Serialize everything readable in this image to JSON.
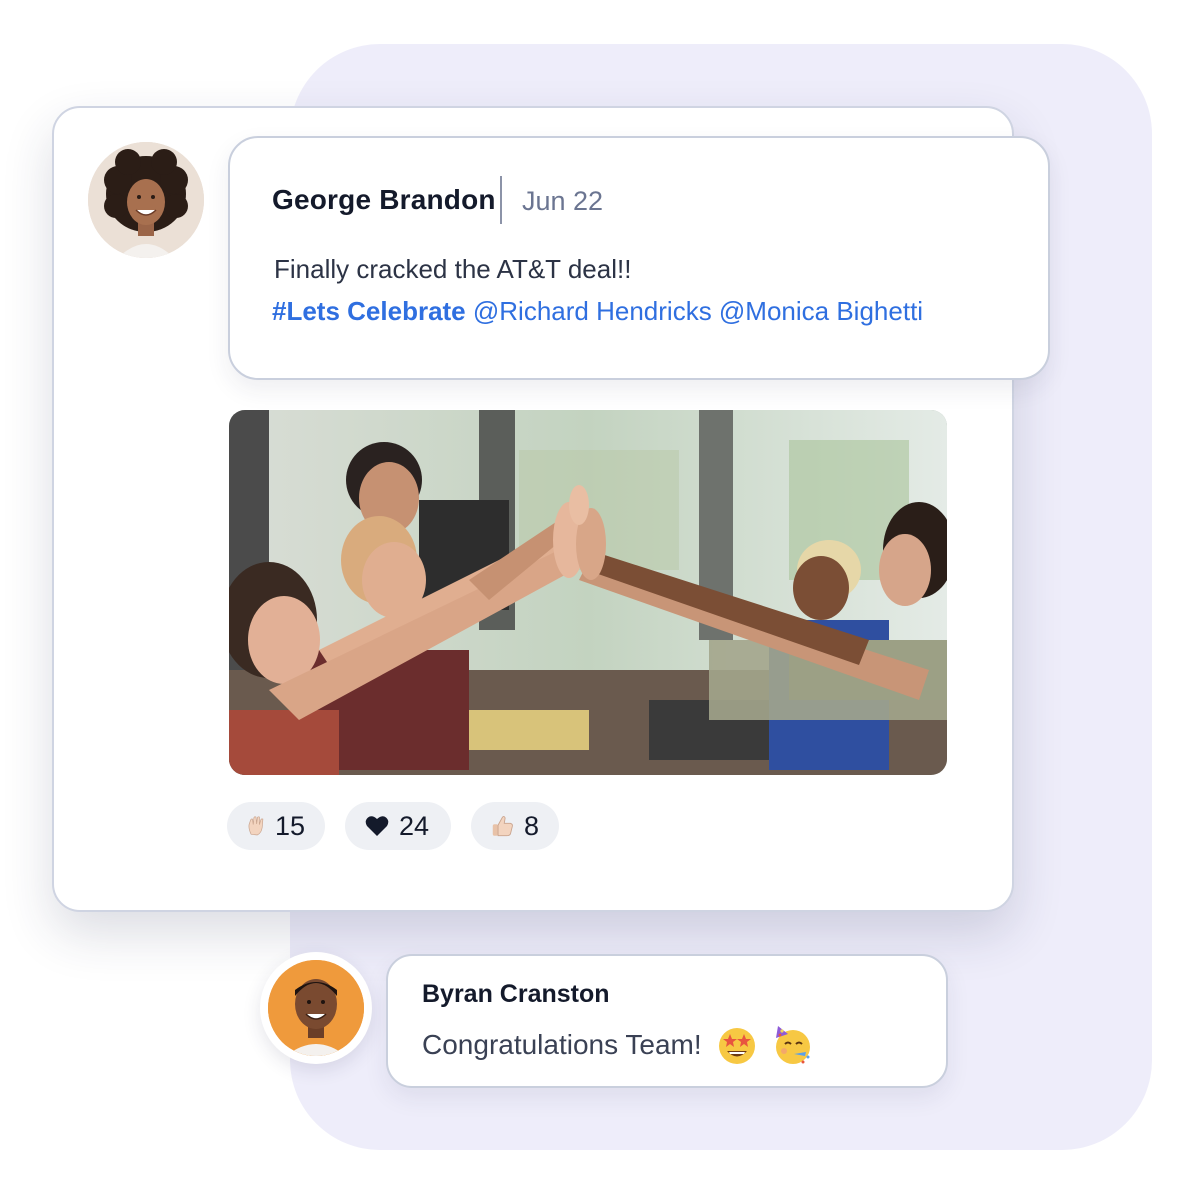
{
  "post": {
    "author": "George Brandon",
    "date": "Jun 22",
    "message": "Finally cracked the AT&T deal!!",
    "hashtag": "#Lets Celebrate",
    "mentions": "@Richard Hendricks @Monica Bighetti",
    "photo_alt": "",
    "colors": {
      "link": "#2f6fe0",
      "background_panel": "#eeedfa"
    }
  },
  "reactions": [
    {
      "icon": "raised-hand-icon",
      "count": "15"
    },
    {
      "icon": "heart-icon",
      "count": "24"
    },
    {
      "icon": "thumbs-up-icon",
      "count": "8"
    }
  ],
  "comment": {
    "author": "Byran Cranston",
    "text": "Congratulations Team!",
    "emojis": [
      "star-struck-icon",
      "party-face-icon"
    ]
  }
}
